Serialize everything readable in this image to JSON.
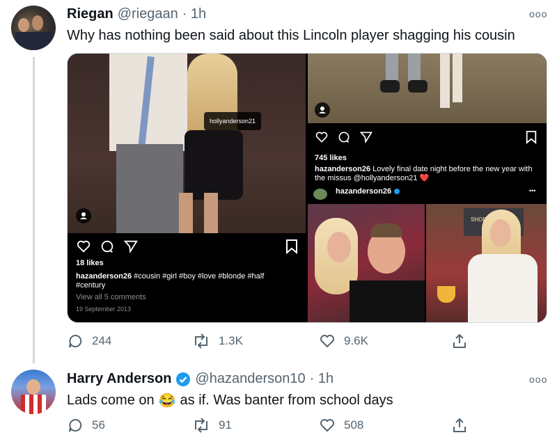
{
  "tweet1": {
    "name": "Riegan",
    "handle": "@riegaan",
    "time": "· 1h",
    "text": "Why has nothing been said about this Lincoln player shagging his cousin",
    "actions": {
      "reply": "244",
      "retweet": "1.3K",
      "like": "9.6K"
    },
    "media": {
      "left": {
        "tag": "hollyanderson21",
        "likes": "18 likes",
        "caption_user": "hazanderson26",
        "caption_text": "#cousin #girl #boy #love #blonde #half #century",
        "comments": "View all 5 comments",
        "date": "19 September 2013"
      },
      "right_top": {
        "likes": "745 likes",
        "caption_user": "hazanderson26",
        "caption_text": "Lovely final date night before the new year with the missus @hollyanderson21 ❤️"
      },
      "right_bottom": {
        "user": "hazanderson26",
        "more": "•••",
        "sign_text": "SHOR"
      }
    }
  },
  "tweet2": {
    "name": "Harry Anderson",
    "handle": "@hazanderson10",
    "time": "· 1h",
    "text_before": "Lads come on",
    "emoji": "😂",
    "text_after": "as if. Was banter from school days",
    "actions": {
      "reply": "56",
      "retweet": "91",
      "like": "508"
    }
  },
  "more_label": "ooo",
  "colors": {
    "text": "#0f1419",
    "muted": "#536471",
    "verified": "#1d9bf0",
    "line": "#cfd9de"
  }
}
